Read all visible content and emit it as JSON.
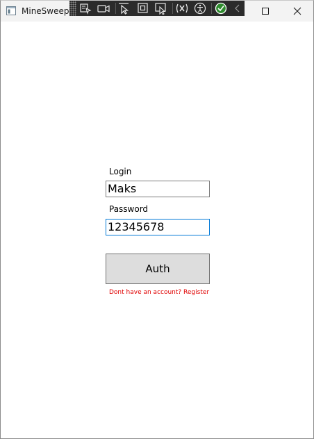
{
  "window": {
    "title": "MineSweeper"
  },
  "devtools": {
    "icons": [
      "select-element-icon",
      "video-icon",
      "pointer-select-icon",
      "layout-adorner-icon",
      "track-focus-icon",
      "binding-failures-icon",
      "accessibility-icon",
      "checkmark-icon",
      "collapse-chevron-icon"
    ]
  },
  "form": {
    "login_label": "Login",
    "login_value": "Maks",
    "password_label": "Password",
    "password_value": "12345678",
    "auth_button": "Auth",
    "register_link": "Dont have an account? Register"
  },
  "colors": {
    "link": "#e00000",
    "focus_border": "#0078d7",
    "button_bg": "#dddddd"
  }
}
